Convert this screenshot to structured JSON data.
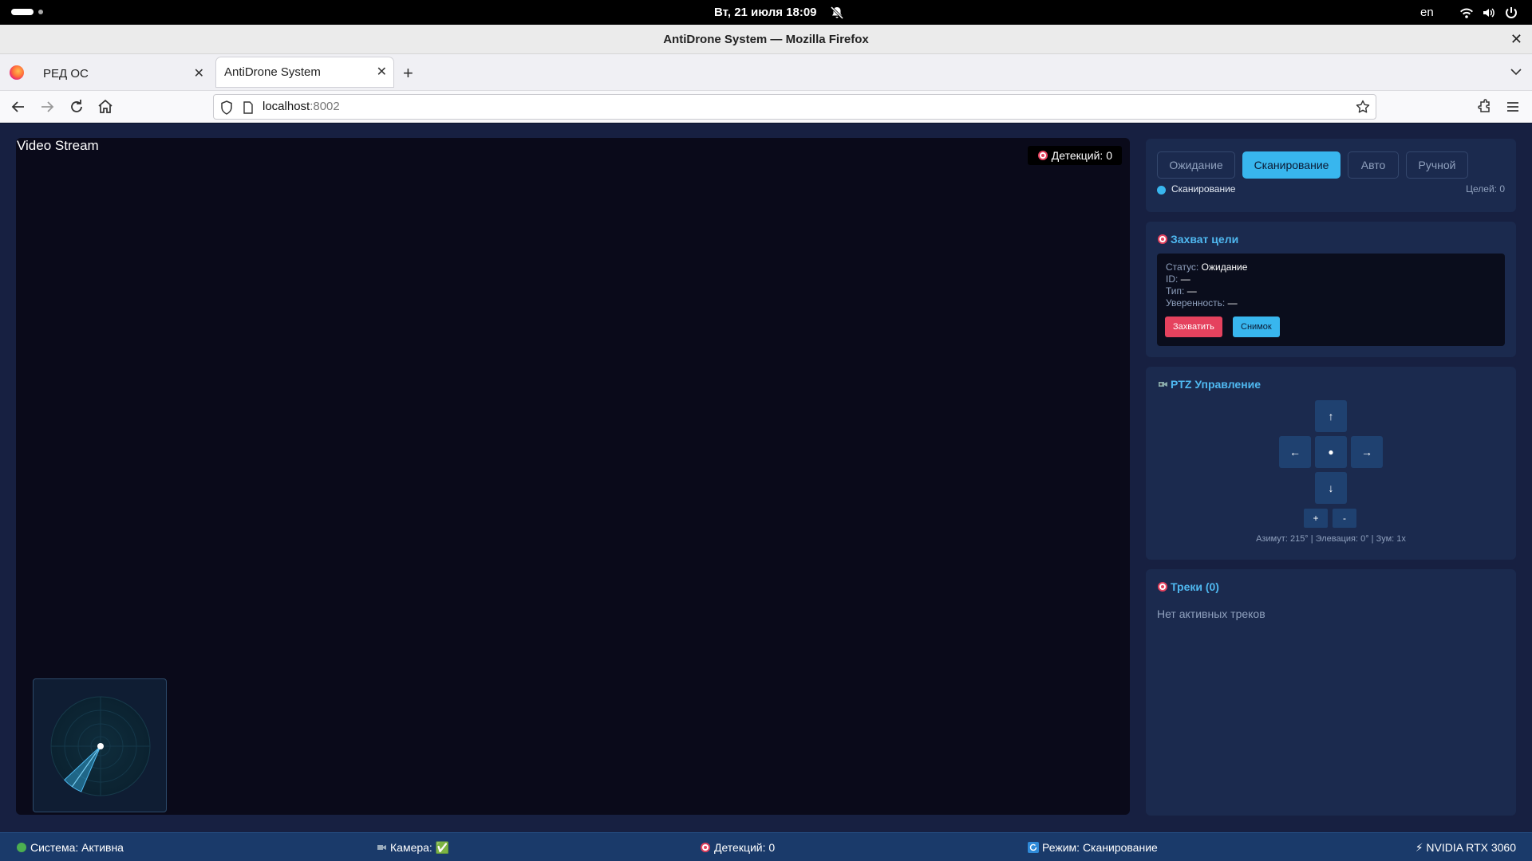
{
  "system": {
    "clock": "Вт, 21 июля  18:09",
    "language": "en"
  },
  "browser": {
    "window_title": "AntiDrone System — Mozilla Firefox",
    "tabs": [
      {
        "label": "РЕД ОС",
        "active": false
      },
      {
        "label": "AntiDrone System",
        "active": true
      }
    ],
    "url_host": "localhost",
    "url_port": ":8002"
  },
  "video": {
    "label": "Video Stream",
    "detections_badge": "Детекций: 0"
  },
  "modes": {
    "buttons": [
      "Ожидание",
      "Сканирование",
      "Авто",
      "Ручной"
    ],
    "active": "Сканирование",
    "status": "Сканирование",
    "targets": "Целей: 0"
  },
  "capture": {
    "title": "Захват цели",
    "status_label": "Статус:",
    "status_value": "Ожидание",
    "id_label": "ID:",
    "id_value": "—",
    "type_label": "Тип:",
    "type_value": "—",
    "conf_label": "Уверенность:",
    "conf_value": "—",
    "capture_btn": "Захватить",
    "snapshot_btn": "Снимок"
  },
  "ptz": {
    "title": "PTZ Управление",
    "up": "↑",
    "left": "←",
    "center": "●",
    "right": "→",
    "down": "↓",
    "zoom_in": "+",
    "zoom_out": "-",
    "info": "Азимут: 215° | Элевация: 0° | Зум: 1x",
    "azimuth_deg": 215
  },
  "tracks": {
    "title": "Треки (0)",
    "empty": "Нет активных треков"
  },
  "status_bar": {
    "system": "Система: Активна",
    "camera": "Камера: ✅",
    "detections": "Детекций: 0",
    "mode": "Режим: Сканирование",
    "gpu": "⚡ NVIDIA RTX 3060"
  },
  "colors": {
    "accent": "#38b6ee",
    "danger": "#e5425e",
    "panel": "#1b2a4e",
    "background": "#172041"
  }
}
